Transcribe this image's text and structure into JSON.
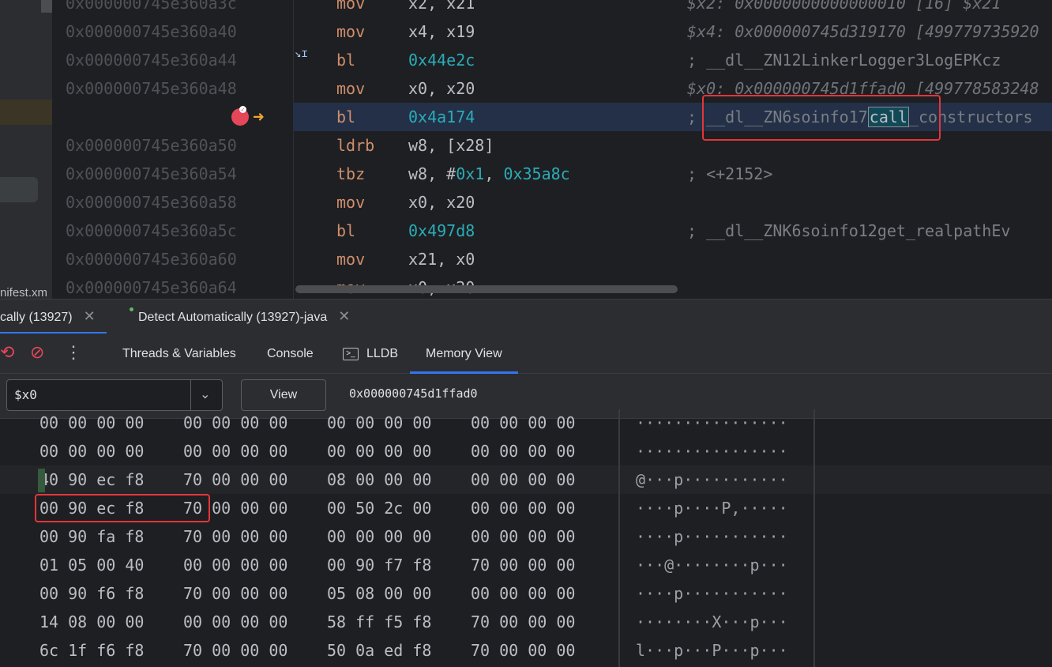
{
  "sidebar": {
    "truncated_label": "nifest.xm"
  },
  "disassembly": {
    "rows": [
      {
        "addr": "0x000000745e360a3c",
        "mnem": "mov",
        "ops": "x2, x21",
        "cmt": "$x2: 0x0000000000000010 [16]    $x21"
      },
      {
        "addr": "0x000000745e360a40",
        "mnem": "mov",
        "ops": "x4, x19",
        "cmt": "$x4: 0x000000745d319170 [499779735920"
      },
      {
        "addr": "0x000000745e360a44",
        "mnem": "bl",
        "ops": "0x44e2c",
        "cmt": "; __dl__ZN12LinkerLogger3LogEPKcz"
      },
      {
        "addr": "0x000000745e360a48",
        "mnem": "mov",
        "ops": "x0, x20",
        "cmt": "$x0: 0x000000745d1ffad0 [499778583248"
      },
      {
        "addr": "",
        "mnem": "bl",
        "ops": "0x4a174",
        "cmt_pre": "; __dl__ZN6soinfo17",
        "cmt_hl": "call",
        "cmt_post": "_constructors"
      },
      {
        "addr": "0x000000745e360a50",
        "mnem": "ldrb",
        "ops": "w8, [x28]",
        "cmt": ""
      },
      {
        "addr": "0x000000745e360a54",
        "mnem": "tbz",
        "ops_pre": "w8, #",
        "ops_n1": "0x1",
        "ops_mid": ", ",
        "ops_n2": "0x35a8c",
        "cmt": "; <+2152>"
      },
      {
        "addr": "0x000000745e360a58",
        "mnem": "mov",
        "ops": "x0, x20",
        "cmt": ""
      },
      {
        "addr": "0x000000745e360a5c",
        "mnem": "bl",
        "ops": "0x497d8",
        "cmt": "; __dl__ZNK6soinfo12get_realpathEv"
      },
      {
        "addr": "0x000000745e360a60",
        "mnem": "mov",
        "ops": "x21, x0",
        "cmt": ""
      },
      {
        "addr": "0x000000745e360a64",
        "mnem": "mov",
        "ops": "x0, x20",
        "cmt": ""
      }
    ]
  },
  "session_tabs": [
    {
      "label": "cally (13927)",
      "close": "✕"
    },
    {
      "label": "Detect Automatically (13927)-java",
      "close": "✕"
    }
  ],
  "view_tabs": {
    "threads": "Threads & Variables",
    "console": "Console",
    "lldb": "LLDB",
    "memory": "Memory View"
  },
  "memory_view": {
    "expression": "$x0",
    "view_button": "View",
    "address": "0x000000745d1ffad0",
    "rows": [
      {
        "g": [
          "00 00 00 00",
          "00 00 00 00",
          "00 00 00 00",
          "00 00 00 00"
        ],
        "ascii": "················"
      },
      {
        "g": [
          "00 00 00 00",
          "00 00 00 00",
          "00 00 00 00",
          "00 00 00 00"
        ],
        "ascii": "················"
      },
      {
        "g": [
          "40 90 ec f8",
          "70 00 00 00",
          "08 00 00 00",
          "00 00 00 00"
        ],
        "ascii": "@···p···········"
      },
      {
        "g": [
          "00 90 ec f8",
          "70 00 00 00",
          "00 50 2c 00",
          "00 00 00 00"
        ],
        "ascii": "····p····P,·····"
      },
      {
        "g": [
          "00 90 fa f8",
          "70 00 00 00",
          "00 00 00 00",
          "00 00 00 00"
        ],
        "ascii": "····p···········"
      },
      {
        "g": [
          "01 05 00 40",
          "00 00 00 00",
          "00 90 f7 f8",
          "70 00 00 00"
        ],
        "ascii": "···@········p···"
      },
      {
        "g": [
          "00 90 f6 f8",
          "70 00 00 00",
          "05 08 00 00",
          "00 00 00 00"
        ],
        "ascii": "····p···········"
      },
      {
        "g": [
          "14 08 00 00",
          "00 00 00 00",
          "58 ff f5 f8",
          "70 00 00 00"
        ],
        "ascii": "········X···p···"
      },
      {
        "g": [
          "6c 1f f6 f8",
          "70 00 00 00",
          "50 0a ed f8",
          "70 00 00 00"
        ],
        "ascii": "l···p···P···p···"
      }
    ]
  },
  "colors": {
    "accent": "#3574f0",
    "highlight_box": "#e5353a",
    "breakpoint": "#e5475a",
    "exec_arrow": "#f0a732"
  },
  "icons": [
    "scroll-icon",
    "breakpoint-icon",
    "execution-arrow-icon",
    "close-icon",
    "rerun-icon",
    "mute-breakpoints-icon",
    "more-icon",
    "terminal-icon",
    "chevron-down-icon"
  ]
}
